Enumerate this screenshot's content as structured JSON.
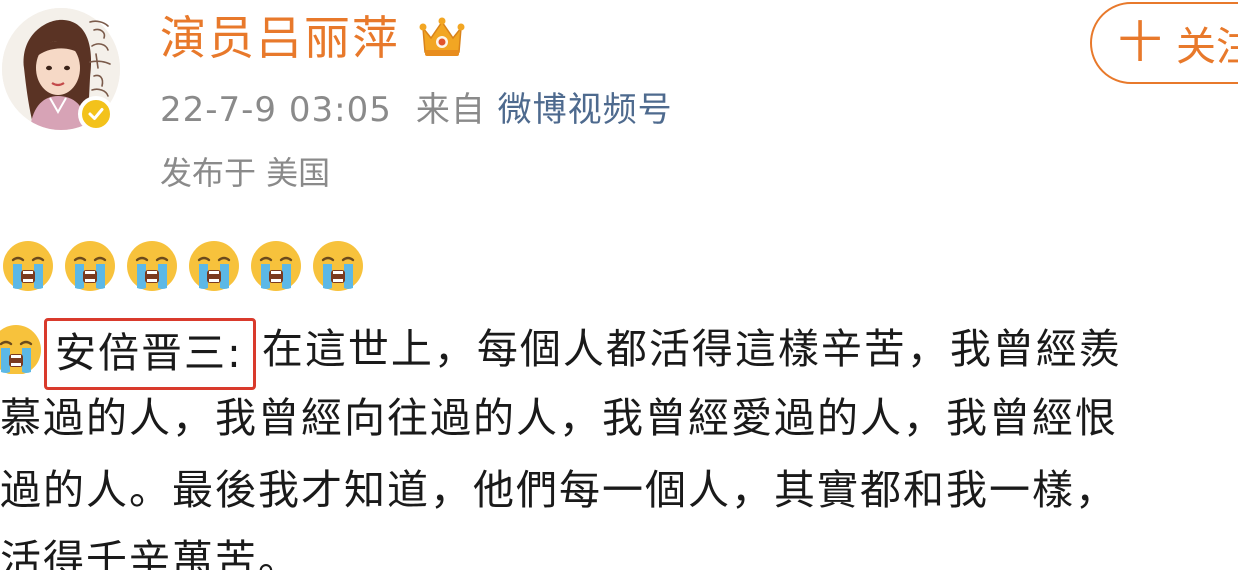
{
  "post": {
    "username": "演员吕丽萍",
    "avatar_signature": "吕丽萍",
    "timestamp": "22-7-9 03:05",
    "from_label": "来自",
    "source": "微博视频号",
    "location": "发布于 美国"
  },
  "follow_button": {
    "plus": "十",
    "label": "关注"
  },
  "body": {
    "emoji_row": [
      "crying-face",
      "crying-face",
      "crying-face",
      "crying-face",
      "crying-face",
      "crying-face"
    ],
    "highlighted": "安倍晋三:",
    "line1": "在這世上，每個人都活得這樣辛苦，我曾經羨",
    "line2": "慕過的人，我曾經向往過的人，我曾經愛過的人，我曾經恨",
    "line3": "過的人。最後我才知道，他們每一個人，其實都和我一樣，",
    "line4": "活得千辛萬苦。"
  },
  "colors": {
    "accent": "#e8792b",
    "source_link": "#4e6a8e",
    "meta": "#8a8a8a",
    "highlight_box": "#d93a2c",
    "verified": "#f3c21b"
  }
}
